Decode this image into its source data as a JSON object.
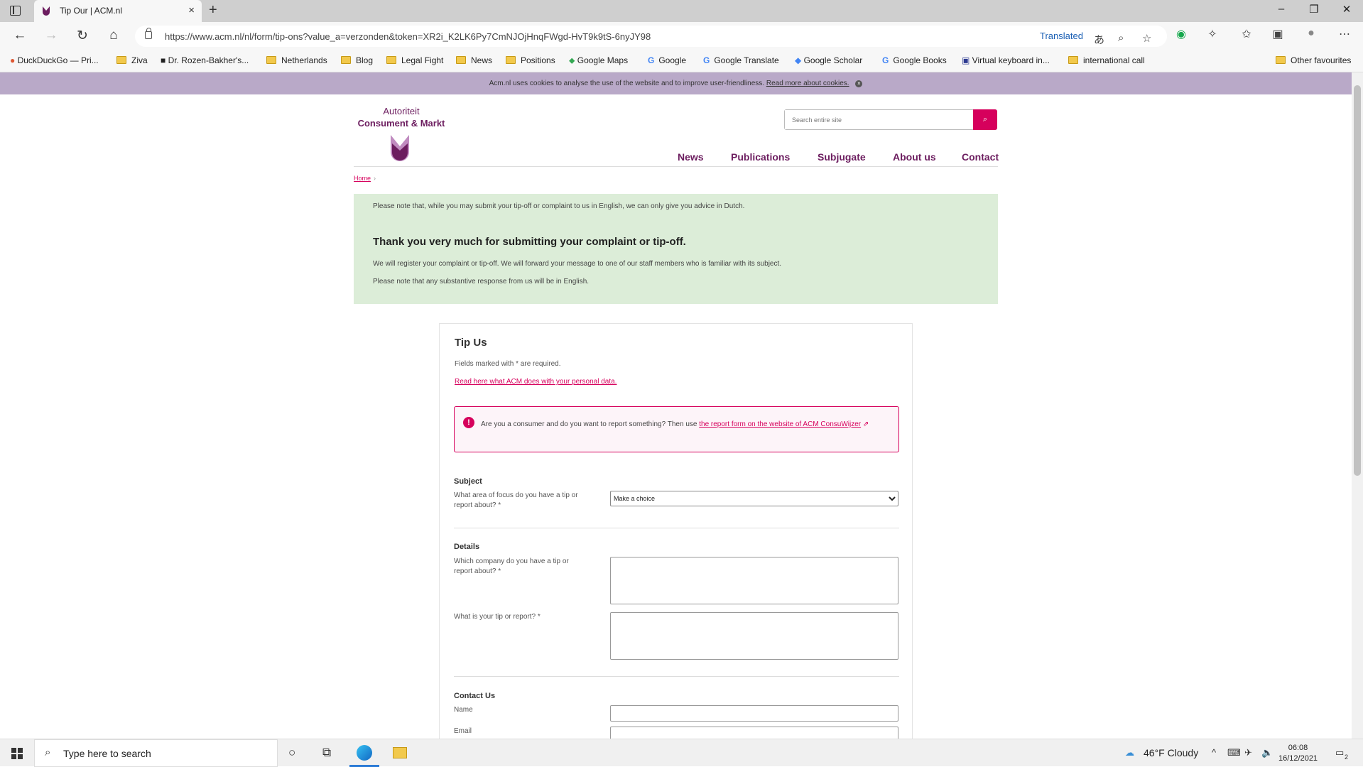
{
  "browser": {
    "tab_title": "Tip Our | ACM.nl",
    "url": "https://www.acm.nl/nl/form/tip-ons?value_a=verzonden&token=XR2i_K2LK6Py7CmNJOjHnqFWgd-HvT9k9tS-6nyJY98",
    "translated_label": "Translated",
    "favorites": [
      "DuckDuckGo — Pri...",
      "Ziva",
      "Dr. Rozen-Bakher's...",
      "Netherlands",
      "Blog",
      "Legal Fight",
      "News",
      "Positions",
      "Google Maps",
      "Google",
      "Google Translate",
      "Google Scholar",
      "Google Books",
      "Virtual keyboard in...",
      "international call",
      "Other favourites"
    ]
  },
  "cookie_bar": {
    "text": "Acm.nl uses cookies to analyse the use of the website and to improve user-friendliness.",
    "link": "Read more about cookies."
  },
  "header": {
    "logo_line1": "Autoriteit",
    "logo_line2": "Consument & Markt",
    "search_placeholder": "Search entire site",
    "nav": [
      "News",
      "Publications",
      "Subjugate",
      "About us",
      "Contact"
    ]
  },
  "breadcrumb": {
    "home": "Home",
    "sep": "›"
  },
  "notice": {
    "note": "Please note that, while you may submit your tip-off or complaint to us in English, we can only give you advice in Dutch.",
    "heading": "Thank you very much for submitting your complaint or tip-off.",
    "line1": "We will register your complaint or tip-off. We will forward your message to one of our staff members who is familiar with its subject.",
    "line2": "Please note that any substantive response from us will be in English."
  },
  "form": {
    "title": "Tip Us",
    "required_note": "Fields marked with * are required.",
    "privacy_link": "Read here what ACM does with your personal data.",
    "alert_text": "Are you a consumer and do you want to report something? Then use",
    "alert_link": "the report form on the website of ACM ConsuWijzer",
    "subject_heading": "Subject",
    "subject_label": "What area of focus do you have a tip or report about? *",
    "subject_selected": "Make a choice",
    "details_heading": "Details",
    "company_label": "Which company do you have a tip or report about? *",
    "tip_label": "What is your tip or report? *",
    "contact_heading": "Contact Us",
    "name_label": "Name",
    "email_label": "Email"
  },
  "taskbar": {
    "search_placeholder": "Type here to search",
    "weather": "46°F  Cloudy",
    "time": "06:08",
    "date": "16/12/2021",
    "notif_count": "2"
  }
}
